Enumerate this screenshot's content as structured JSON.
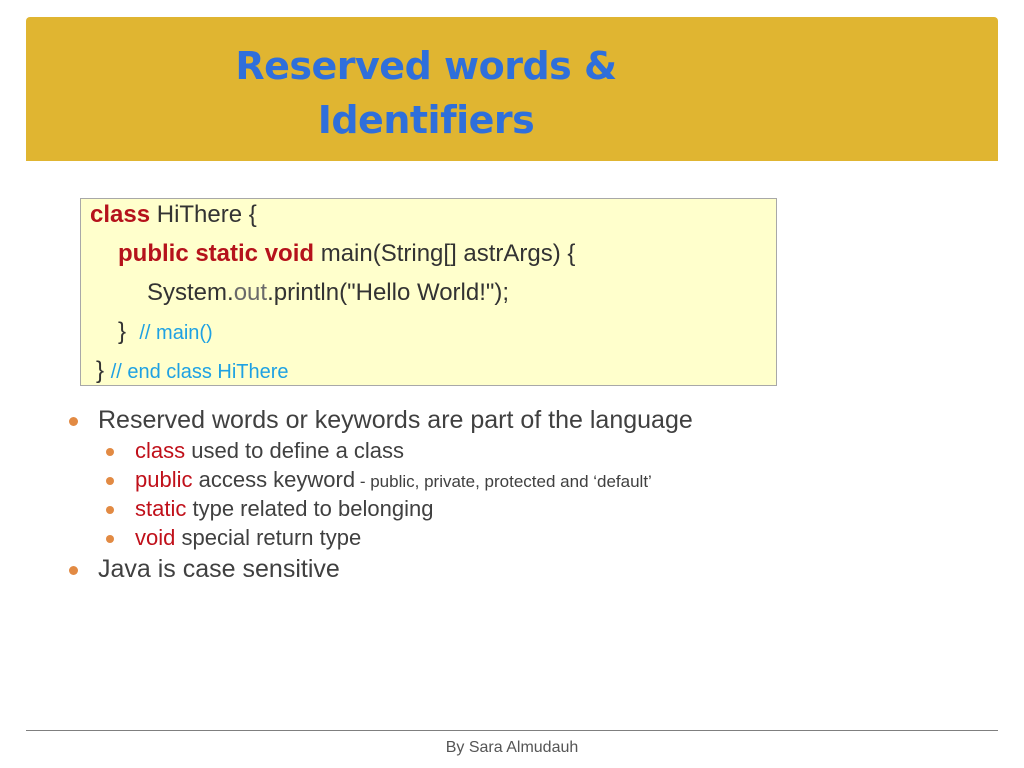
{
  "slide": {
    "title_line1": "Reserved words &",
    "title_line2": "Identifiers",
    "footer": "By Sara Almudauh"
  },
  "code": {
    "line1": {
      "keyword": "class",
      "text": " HiThere {"
    },
    "line2": {
      "keywords": "public static void",
      "text": " main(String[] astrArgs) {"
    },
    "line3": {
      "prefix": "System.",
      "field": "out",
      "suffix": ".println(\"Hello World!\");"
    },
    "line4": {
      "brace": "}",
      "comment": "// main()"
    },
    "line5": {
      "brace": "}",
      "comment": "// end class HiThere"
    }
  },
  "bullets": [
    {
      "text": "Reserved words or keywords are part of the language"
    },
    {
      "keyword": "class",
      "text": " used to define a class"
    },
    {
      "keyword": "public",
      "text": " access keyword",
      "note": " - public, private, protected and ‘default’"
    },
    {
      "keyword": "static",
      "text": " type related to belonging"
    },
    {
      "keyword": "void",
      "text": " special return type"
    },
    {
      "text": "Java is case sensitive"
    }
  ],
  "colors": {
    "title_band": "#e0b531",
    "title_text": "#2f6fdb",
    "keyword": "#b5121b",
    "comment": "#1ea1e3",
    "bullet_dot": "#e28a43",
    "code_bg": "#ffffcc"
  }
}
